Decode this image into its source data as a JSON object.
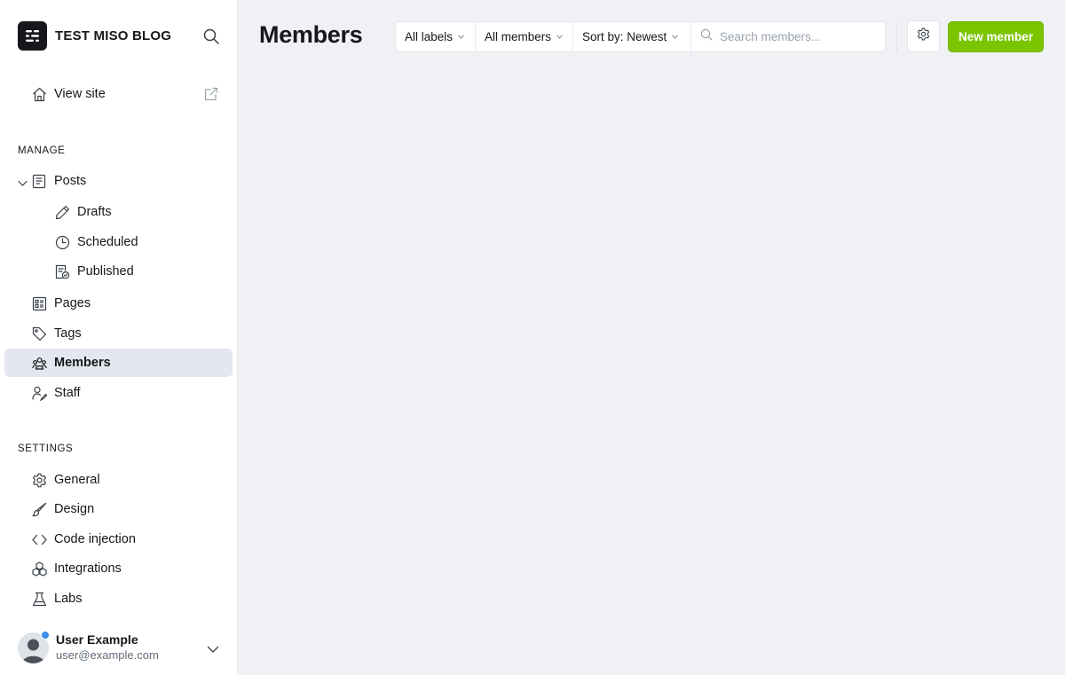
{
  "sidebar": {
    "brand_name": "TEST MISO BLOG",
    "view_site": "View site",
    "manage_heading": "MANAGE",
    "settings_heading": "SETTINGS",
    "items": {
      "posts": "Posts",
      "drafts": "Drafts",
      "scheduled": "Scheduled",
      "published": "Published",
      "pages": "Pages",
      "tags": "Tags",
      "members": "Members",
      "staff": "Staff",
      "general": "General",
      "design": "Design",
      "code_injection": "Code injection",
      "integrations": "Integrations",
      "labs": "Labs"
    },
    "user": {
      "name": "User Example",
      "email": "user@example.com"
    }
  },
  "main": {
    "title": "Members",
    "filters": {
      "labels": "All labels",
      "members": "All members",
      "sort": "Sort by: Newest"
    },
    "search": {
      "placeholder": "Search members..."
    },
    "new_button": "New member"
  },
  "colors": {
    "accent_green": "#7bc400",
    "active_bg": "#e5e7f0",
    "page_bg": "#f0f1f5",
    "online_dot": "#3b8eea"
  }
}
